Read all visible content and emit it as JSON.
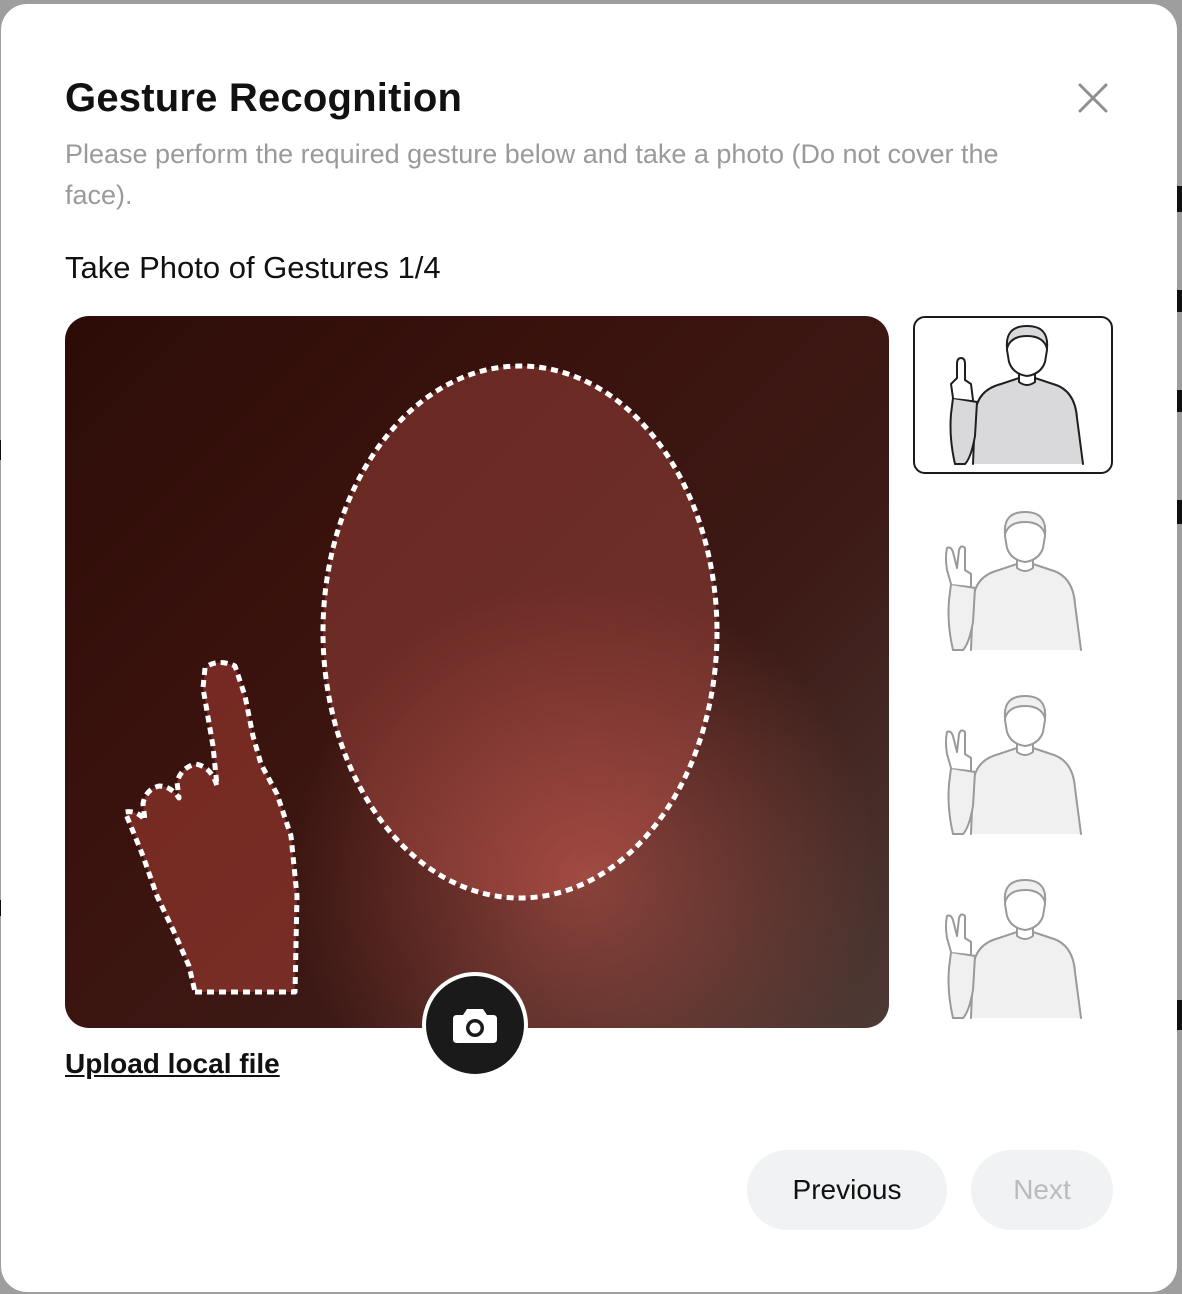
{
  "modal": {
    "title": "Gesture Recognition",
    "subtitle": "Please perform the required gesture below and take a photo (Do not cover the face).",
    "step_title": "Take Photo of Gestures 1/4",
    "upload_label": "Upload local file",
    "previous_label": "Previous",
    "next_label": "Next",
    "close_icon": "close-icon",
    "shutter_icon": "camera-icon"
  },
  "gestures": [
    {
      "name": "index-finger-up",
      "active": true
    },
    {
      "name": "v-sign",
      "active": false
    },
    {
      "name": "v-sign",
      "active": false
    },
    {
      "name": "v-sign",
      "active": false
    }
  ],
  "colors": {
    "accent": "#1a1a1a",
    "muted_text": "#9a9a9a",
    "button_bg": "#f1f2f4",
    "disabled_text": "#b9bbbf"
  }
}
